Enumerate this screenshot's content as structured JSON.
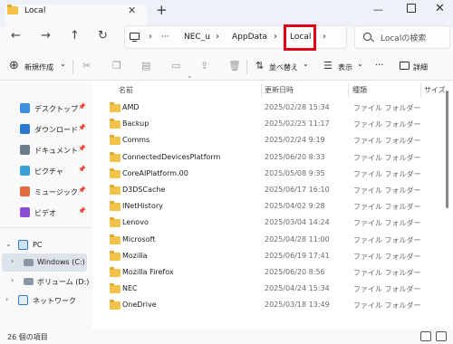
{
  "tab": {
    "title": "Local",
    "close": "✕",
    "add": "+"
  },
  "window": {
    "minimize": "—",
    "close": "✕"
  },
  "nav": {
    "back": "←",
    "forward": "→",
    "up": "↑",
    "refresh": "↻",
    "more": "···"
  },
  "address": {
    "crumbs": [
      "NEC_u",
      "AppData",
      "Local"
    ],
    "sep": "›"
  },
  "search": {
    "placeholder": "Localの検索"
  },
  "toolbar": {
    "new_label": "新規作成",
    "new_chevron": "⌄",
    "sort_label": "並べ替え",
    "view_label": "表示",
    "more": "···",
    "details_label": "詳細"
  },
  "sidebar": {
    "quick": [
      {
        "label": "デスクトップ",
        "icon": "desktop-icon",
        "color": "#3b8ee0"
      },
      {
        "label": "ダウンロード",
        "icon": "download-icon",
        "color": "#2a7ad1"
      },
      {
        "label": "ドキュメント",
        "icon": "document-icon",
        "color": "#6b7b8c"
      },
      {
        "label": "ピクチャ",
        "icon": "pictures-icon",
        "color": "#3aa0d8"
      },
      {
        "label": "ミュージック",
        "icon": "music-icon",
        "color": "#e06b3c"
      },
      {
        "label": "ビデオ",
        "icon": "video-icon",
        "color": "#8a4fd6"
      }
    ],
    "pc": {
      "label": "PC",
      "chev": "⌄"
    },
    "drives": [
      {
        "label": "Windows (C:)",
        "chev": "›"
      },
      {
        "label": "ボリューム (D:)",
        "chev": "›"
      }
    ],
    "network": {
      "label": "ネットワーク",
      "chev": "›"
    }
  },
  "columns": {
    "name": "名前",
    "date": "更新日時",
    "type": "種類",
    "size": "サイズ"
  },
  "files": [
    {
      "name": "AMD",
      "date": "2025/02/28 15:34",
      "type": "ファイル フォルダー"
    },
    {
      "name": "Backup",
      "date": "2025/02/25 11:17",
      "type": "ファイル フォルダー"
    },
    {
      "name": "Comms",
      "date": "2025/02/24 9:19",
      "type": "ファイル フォルダー"
    },
    {
      "name": "ConnectedDevicesPlatform",
      "date": "2025/06/20 8:33",
      "type": "ファイル フォルダー"
    },
    {
      "name": "CoreAIPlatform.00",
      "date": "2025/05/08 9:35",
      "type": "ファイル フォルダー"
    },
    {
      "name": "D3DSCache",
      "date": "2025/06/17 16:10",
      "type": "ファイル フォルダー"
    },
    {
      "name": "INetHistory",
      "date": "2025/04/02 9:28",
      "type": "ファイル フォルダー"
    },
    {
      "name": "Lenovo",
      "date": "2025/03/04 14:24",
      "type": "ファイル フォルダー"
    },
    {
      "name": "Microsoft",
      "date": "2025/04/28 11:00",
      "type": "ファイル フォルダー"
    },
    {
      "name": "Mozilla",
      "date": "2025/06/19 17:41",
      "type": "ファイル フォルダー"
    },
    {
      "name": "Mozilla Firefox",
      "date": "2025/06/20 8:56",
      "type": "ファイル フォルダー"
    },
    {
      "name": "NEC",
      "date": "2025/04/24 15:34",
      "type": "ファイル フォルダー"
    },
    {
      "name": "OneDrive",
      "date": "2025/03/18 13:49",
      "type": "ファイル フォルダー"
    }
  ],
  "status": {
    "count": "26 個の項目"
  },
  "colors": {
    "highlight": "#e0001a",
    "folder": "#f3c249",
    "selected": "#dde3ea"
  }
}
